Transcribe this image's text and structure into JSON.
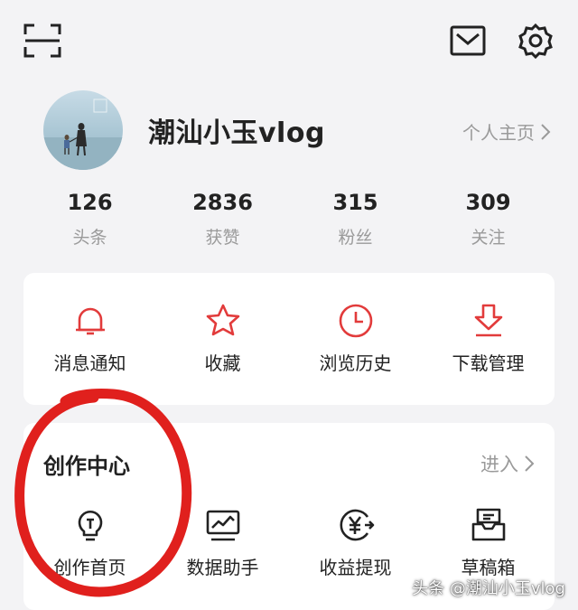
{
  "header": {
    "scan_icon": "scan-icon",
    "mail_icon": "mail-icon",
    "settings_icon": "gear-icon"
  },
  "profile": {
    "username": "潮汕小玉vlog",
    "homepage_label": "个人主页"
  },
  "stats": [
    {
      "value": "126",
      "label": "头条"
    },
    {
      "value": "2836",
      "label": "获赞"
    },
    {
      "value": "315",
      "label": "粉丝"
    },
    {
      "value": "309",
      "label": "关注"
    }
  ],
  "quick_actions": [
    {
      "label": "消息通知",
      "icon": "bell-icon"
    },
    {
      "label": "收藏",
      "icon": "star-icon"
    },
    {
      "label": "浏览历史",
      "icon": "clock-icon"
    },
    {
      "label": "下载管理",
      "icon": "download-icon"
    }
  ],
  "creator_center": {
    "title": "创作中心",
    "enter_label": "进入",
    "items": [
      {
        "label": "创作首页",
        "icon": "lightbulb-icon"
      },
      {
        "label": "数据助手",
        "icon": "chart-icon"
      },
      {
        "label": "收益提现",
        "icon": "yuan-icon"
      },
      {
        "label": "草稿箱",
        "icon": "inbox-icon"
      }
    ]
  },
  "watermark": "头条 @潮汕小玉vlog",
  "colors": {
    "accent_red": "#e23b3b",
    "text_primary": "#222222",
    "text_secondary": "#9a9a9a",
    "background": "#f3f3f5",
    "annotation_red": "#e0201d"
  }
}
